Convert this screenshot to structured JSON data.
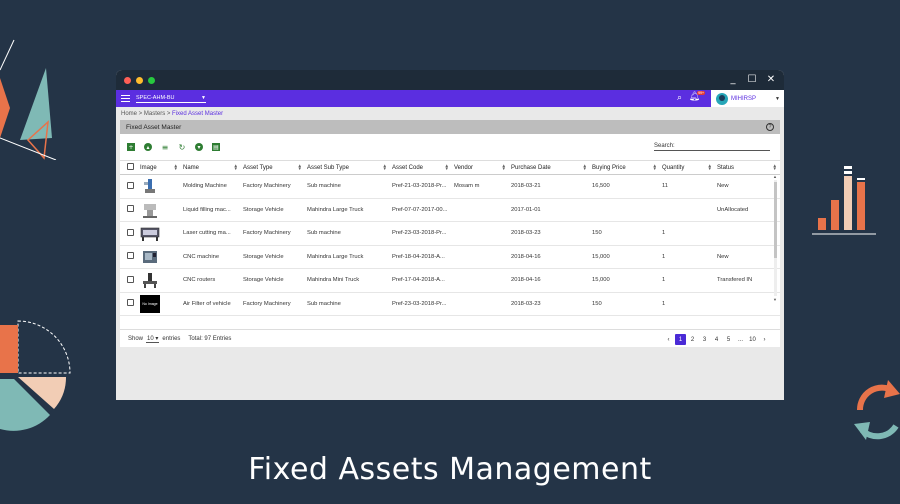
{
  "window": {
    "dot_colors": [
      "#ff5f56",
      "#ffbd2e",
      "#27c93f"
    ],
    "controls": [
      "_",
      "☐",
      "✕"
    ]
  },
  "appbar": {
    "org_unit": "SPEC-AHM-BU",
    "notification_count": "99+",
    "user": "MIHIRSP"
  },
  "breadcrumb": {
    "home": "Home",
    "masters": "Masters",
    "current": "Fixed Asset Master",
    "separator": " > "
  },
  "panel": {
    "title": "Fixed Asset Master",
    "help": "?"
  },
  "toolbar": {
    "search_label": "Search:"
  },
  "table": {
    "columns": [
      "Image",
      "Name",
      "Asset Type",
      "Asset Sub Type",
      "Asset Code",
      "Vendor",
      "Purchase Date",
      "Buying Price",
      "Quantity",
      "Status"
    ],
    "rows": [
      {
        "image": "molding",
        "name": "Molding Machine",
        "asset_type": "Factory Machinery",
        "asset_sub_type": "Sub machine",
        "asset_code": "Pref-21-03-2018-Pr...",
        "vendor": "Mosam m",
        "purchase_date": "2018-03-21",
        "buying_price": "16,500",
        "quantity": "11",
        "status": "New"
      },
      {
        "image": "liquid",
        "name": "Liquid filling mac...",
        "asset_type": "Storage Vehicle",
        "asset_sub_type": "Mahindra Large Truck",
        "asset_code": "Pref-07-07-2017-00...",
        "vendor": "",
        "purchase_date": "2017-01-01",
        "buying_price": "",
        "quantity": "",
        "status": "UnAllocated"
      },
      {
        "image": "laser",
        "name": "Laser cutting ma...",
        "asset_type": "Factory Machinery",
        "asset_sub_type": "Sub machine",
        "asset_code": "Pref-23-03-2018-Pr...",
        "vendor": "",
        "purchase_date": "2018-03-23",
        "buying_price": "150",
        "quantity": "1",
        "status": ""
      },
      {
        "image": "cnc",
        "name": "CNC machine",
        "asset_type": "Storage Vehicle",
        "asset_sub_type": "Mahindra Large Truck",
        "asset_code": "Pref-18-04-2018-A...",
        "vendor": "",
        "purchase_date": "2018-04-16",
        "buying_price": "15,000",
        "quantity": "1",
        "status": "New"
      },
      {
        "image": "router",
        "name": "CNC routers",
        "asset_type": "Storage Vehicle",
        "asset_sub_type": "Mahindra Mini Truck",
        "asset_code": "Pref-17-04-2018-A...",
        "vendor": "",
        "purchase_date": "2018-04-16",
        "buying_price": "15,000",
        "quantity": "1",
        "status": "Transfered IN"
      },
      {
        "image": "noimage",
        "name": "Air Filter of vehicle",
        "asset_type": "Factory Machinery",
        "asset_sub_type": "Sub machine",
        "asset_code": "Pref-23-03-2018-Pr...",
        "vendor": "",
        "purchase_date": "2018-03-23",
        "buying_price": "150",
        "quantity": "1",
        "status": ""
      }
    ],
    "no_image_text": "No Image"
  },
  "footer": {
    "show_label": "Show",
    "page_size": "10",
    "entries_label": "entries",
    "total_text": "Total: 97 Entries",
    "pages": [
      "1",
      "2",
      "3",
      "4",
      "5",
      "...",
      "10"
    ],
    "prev": "‹",
    "next": "›"
  },
  "caption": "Fixed Assets Management",
  "colors": {
    "background": "#243447",
    "appbar": "#5b2ee0",
    "accent_orange": "#e8734a",
    "accent_teal": "#7fb9b5",
    "accent_peach": "#f2cdb5"
  }
}
